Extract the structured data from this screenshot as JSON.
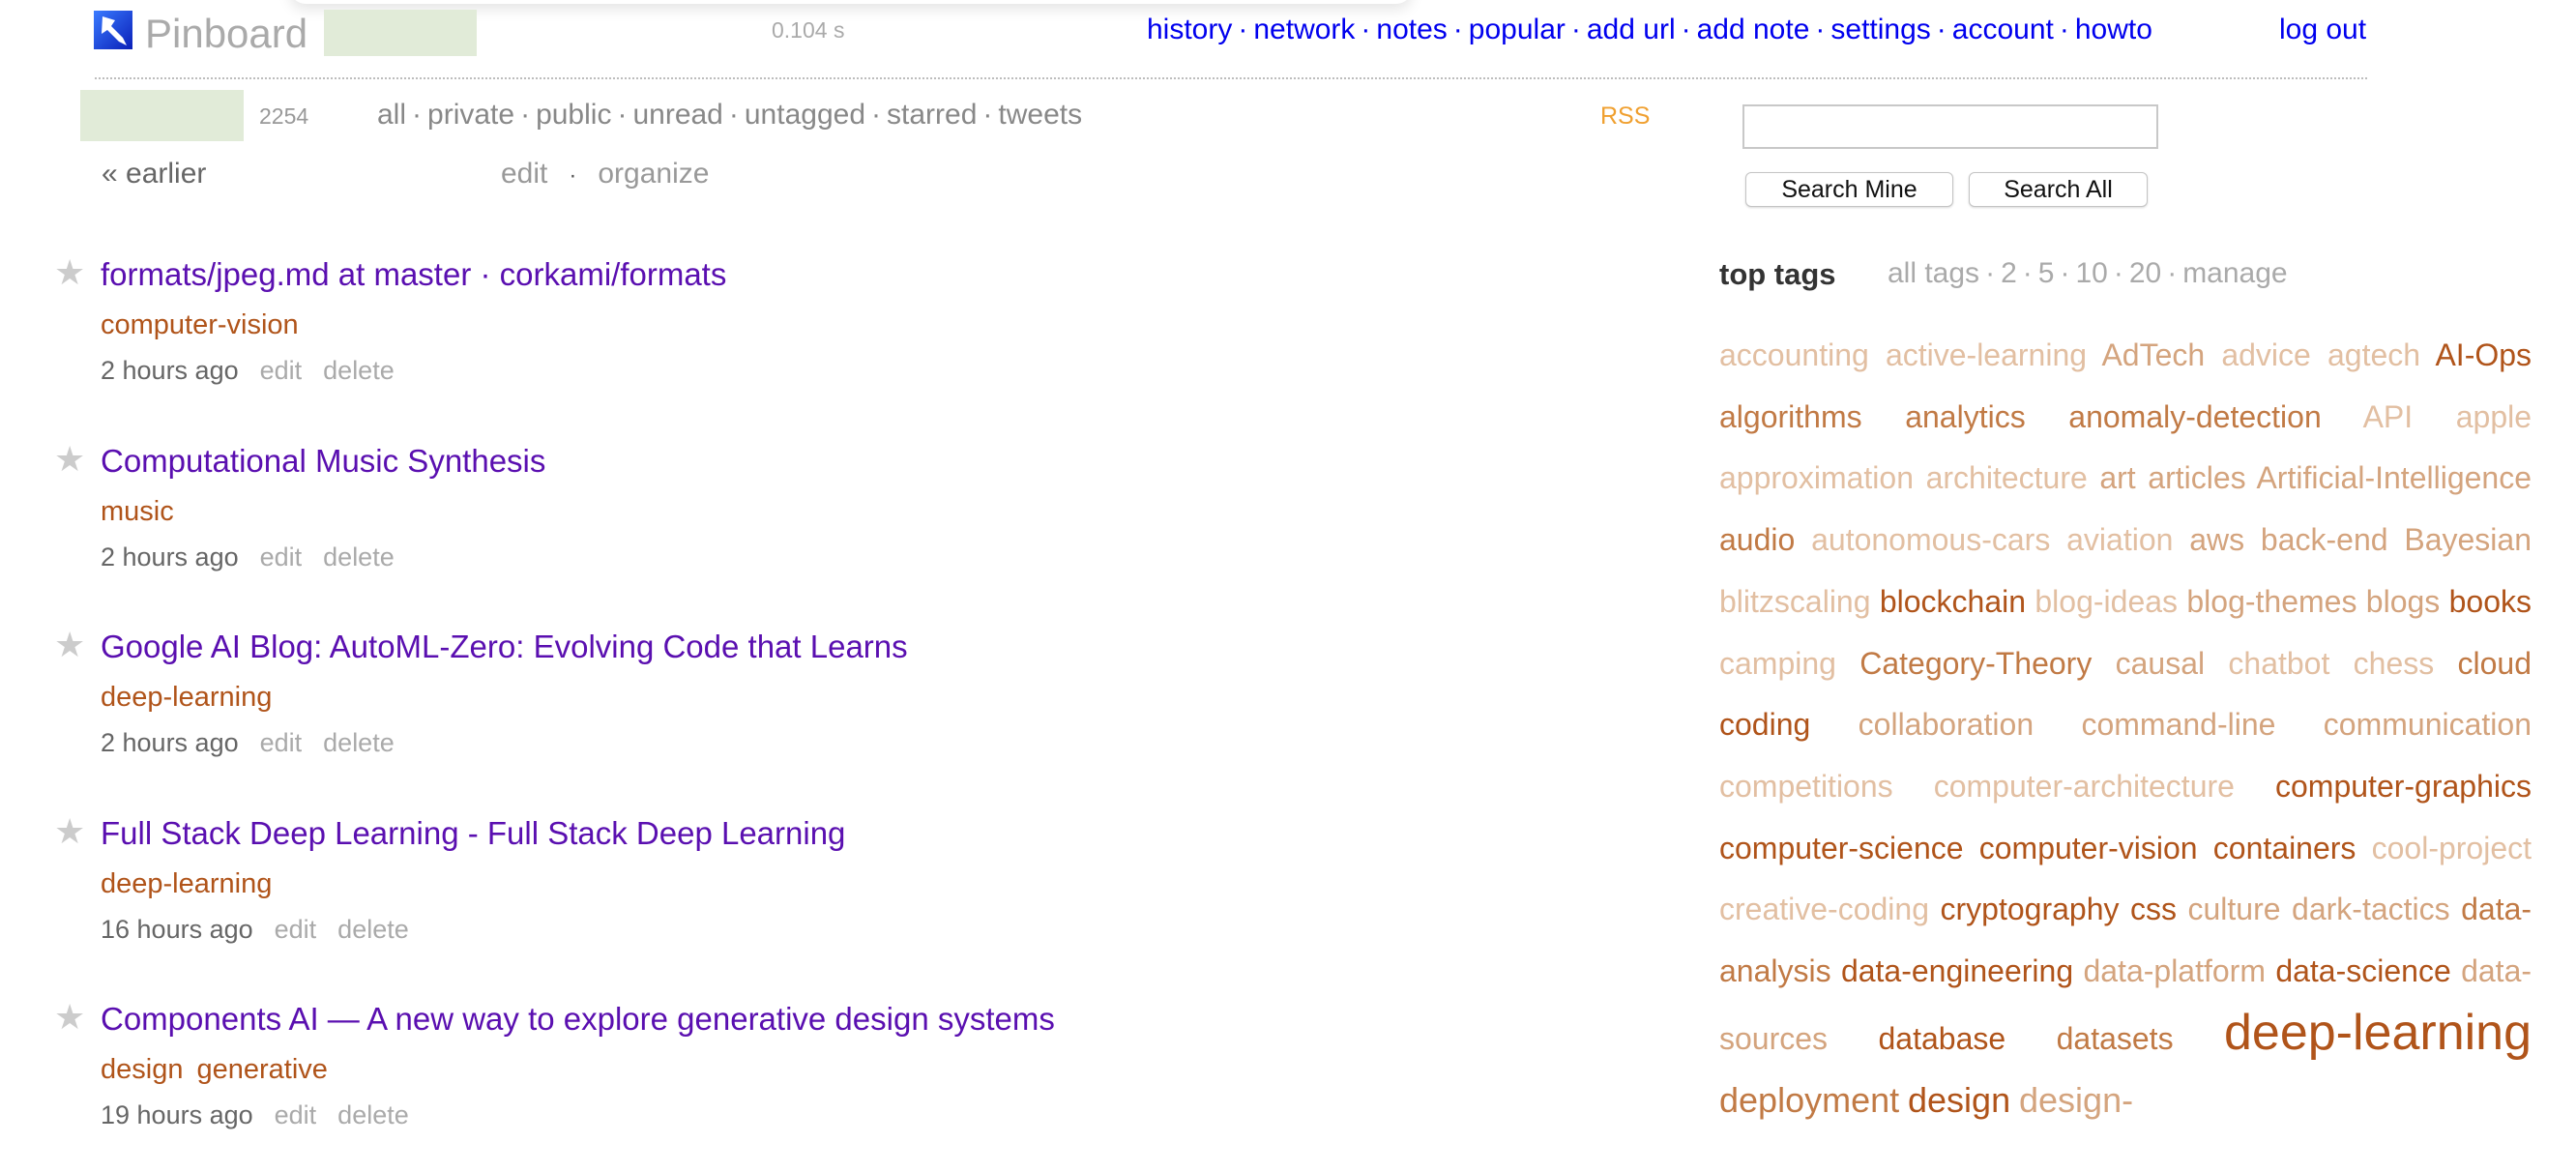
{
  "header": {
    "brand": "Pinboard",
    "timing": "0.104 s",
    "nav": [
      {
        "label": "history"
      },
      {
        "label": "network"
      },
      {
        "label": "notes"
      },
      {
        "label": "popular"
      },
      {
        "label": "add url"
      },
      {
        "label": "add note"
      },
      {
        "label": "settings"
      },
      {
        "label": "account"
      },
      {
        "label": "howto"
      }
    ],
    "separator": "·",
    "logout": "log out"
  },
  "subheader": {
    "bookmark_count": "2254",
    "filters": [
      {
        "label": "all"
      },
      {
        "label": "private"
      },
      {
        "label": "public"
      },
      {
        "label": "unread"
      },
      {
        "label": "untagged"
      },
      {
        "label": "starred"
      },
      {
        "label": "tweets"
      }
    ],
    "rss": "RSS",
    "earlier": "« earlier",
    "edit": "edit",
    "organize": "organize"
  },
  "search": {
    "value": "",
    "placeholder": "",
    "search_mine": "Search Mine",
    "search_all": "Search All"
  },
  "bookmarks": [
    {
      "title": "formats/jpeg.md at master · corkami/formats",
      "tags": [
        "computer-vision"
      ],
      "time": "2 hours ago",
      "edit": "edit",
      "delete": "delete"
    },
    {
      "title": "Computational Music Synthesis",
      "tags": [
        "music"
      ],
      "time": "2 hours ago",
      "edit": "edit",
      "delete": "delete"
    },
    {
      "title": "Google AI Blog: AutoML-Zero: Evolving Code that Learns",
      "tags": [
        "deep-learning"
      ],
      "time": "2 hours ago",
      "edit": "edit",
      "delete": "delete"
    },
    {
      "title": "Full Stack Deep Learning - Full Stack Deep Learning",
      "tags": [
        "deep-learning"
      ],
      "time": "16 hours ago",
      "edit": "edit",
      "delete": "delete"
    },
    {
      "title": "Components AI — A new way to explore generative design systems",
      "tags": [
        "design",
        "generative"
      ],
      "time": "19 hours ago",
      "edit": "edit",
      "delete": "delete"
    }
  ],
  "top_tags": {
    "title": "top tags",
    "links": [
      {
        "label": "all tags"
      },
      {
        "label": "2"
      },
      {
        "label": "5"
      },
      {
        "label": "10"
      },
      {
        "label": "20"
      },
      {
        "label": "manage"
      }
    ],
    "tags": [
      {
        "name": "accounting",
        "weight": 1
      },
      {
        "name": "active-learning",
        "weight": 1
      },
      {
        "name": "AdTech",
        "weight": 2
      },
      {
        "name": "advice",
        "weight": 1
      },
      {
        "name": "agtech",
        "weight": 1
      },
      {
        "name": "AI-Ops",
        "weight": 4
      },
      {
        "name": "algorithms",
        "weight": 3
      },
      {
        "name": "analytics",
        "weight": 3
      },
      {
        "name": "anomaly-detection",
        "weight": 3
      },
      {
        "name": "API",
        "weight": 1
      },
      {
        "name": "apple",
        "weight": 1
      },
      {
        "name": "approximation",
        "weight": 1
      },
      {
        "name": "architecture",
        "weight": 1
      },
      {
        "name": "art",
        "weight": 2
      },
      {
        "name": "articles",
        "weight": 2
      },
      {
        "name": "Artificial-Intelligence",
        "weight": 2
      },
      {
        "name": "audio",
        "weight": 3
      },
      {
        "name": "autonomous-cars",
        "weight": 1
      },
      {
        "name": "aviation",
        "weight": 1
      },
      {
        "name": "aws",
        "weight": 2
      },
      {
        "name": "back-end",
        "weight": 2
      },
      {
        "name": "Bayesian",
        "weight": 2
      },
      {
        "name": "blitzscaling",
        "weight": 1
      },
      {
        "name": "blockchain",
        "weight": 4
      },
      {
        "name": "blog-ideas",
        "weight": 1
      },
      {
        "name": "blog-themes",
        "weight": 2
      },
      {
        "name": "blogs",
        "weight": 2
      },
      {
        "name": "books",
        "weight": 4
      },
      {
        "name": "camping",
        "weight": 1
      },
      {
        "name": "Category-Theory",
        "weight": 3
      },
      {
        "name": "causal",
        "weight": 2
      },
      {
        "name": "chatbot",
        "weight": 1
      },
      {
        "name": "chess",
        "weight": 1
      },
      {
        "name": "cloud",
        "weight": 3
      },
      {
        "name": "coding",
        "weight": 4
      },
      {
        "name": "collaboration",
        "weight": 2
      },
      {
        "name": "command-line",
        "weight": 2
      },
      {
        "name": "communication",
        "weight": 2
      },
      {
        "name": "competitions",
        "weight": 1
      },
      {
        "name": "computer-architecture",
        "weight": 1
      },
      {
        "name": "computer-graphics",
        "weight": 4
      },
      {
        "name": "computer-science",
        "weight": 4
      },
      {
        "name": "computer-vision",
        "weight": 4
      },
      {
        "name": "containers",
        "weight": 4
      },
      {
        "name": "cool-project",
        "weight": 1
      },
      {
        "name": "creative-coding",
        "weight": 1
      },
      {
        "name": "cryptography",
        "weight": 4
      },
      {
        "name": "css",
        "weight": 4
      },
      {
        "name": "culture",
        "weight": 2
      },
      {
        "name": "dark-tactics",
        "weight": 2
      },
      {
        "name": "data-analysis",
        "weight": 3
      },
      {
        "name": "data-engineering",
        "weight": 4
      },
      {
        "name": "data-platform",
        "weight": 2
      },
      {
        "name": "data-science",
        "weight": 4
      },
      {
        "name": "data-sources",
        "weight": 2
      },
      {
        "name": "database",
        "weight": 4
      },
      {
        "name": "datasets",
        "weight": 3
      },
      {
        "name": "deep-learning",
        "weight": 5
      },
      {
        "name": "deployment",
        "weight": 3
      },
      {
        "name": "design",
        "weight": 4
      },
      {
        "name": "design-",
        "weight": 2
      }
    ]
  },
  "colors": {
    "link_blue": "#0000ee",
    "title_purple": "#5a0fb0",
    "tag_brown": "#b0541a",
    "rss_orange": "#f0a030",
    "redaction_green": "#e1ebd8"
  }
}
